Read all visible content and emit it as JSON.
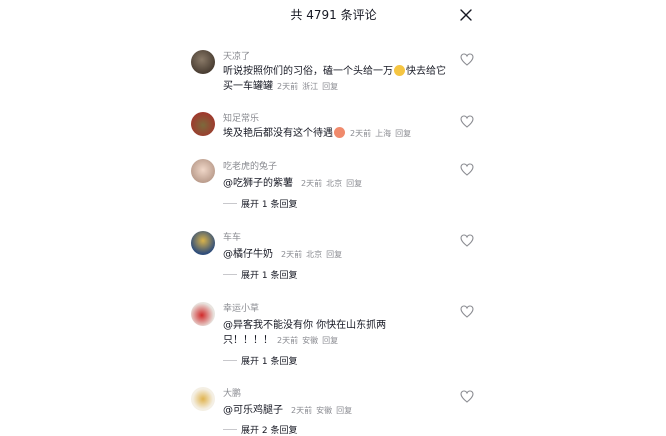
{
  "header": {
    "title": "共 4791 条评论"
  },
  "comments": [
    {
      "username": "天凉了",
      "text1": "听说按照你们的习俗，磕一个头给一万",
      "emoji1": "smiley-emoji",
      "text2": "快去给它买一车罐罐",
      "time": "2天前",
      "location": "浙江",
      "reply": "回复"
    },
    {
      "username": "知足常乐",
      "text1": "埃及艳后都没有这个待遇",
      "emoji1": "laughing-emoji",
      "time": "2天前",
      "location": "上海",
      "reply": "回复"
    },
    {
      "username": "吃老虎的兔子",
      "text1": "@吃狮子的紫薯",
      "time": "2天前",
      "location": "北京",
      "reply": "回复",
      "expand": "展开 1 条回复"
    },
    {
      "username": "车车",
      "text1": "@橘仔牛奶",
      "time": "2天前",
      "location": "北京",
      "reply": "回复",
      "expand": "展开 1 条回复"
    },
    {
      "username": "幸运小草",
      "text1": "@异客我不能没有你  你快在山东抓两只！！！！",
      "time": "2天前",
      "location": "安徽",
      "reply": "回复",
      "expand": "展开 1 条回复"
    },
    {
      "username": "大鹏",
      "text1": "@可乐鸡腿子",
      "time": "2天前",
      "location": "安徽",
      "reply": "回复",
      "expand": "展开 2 条回复"
    }
  ]
}
